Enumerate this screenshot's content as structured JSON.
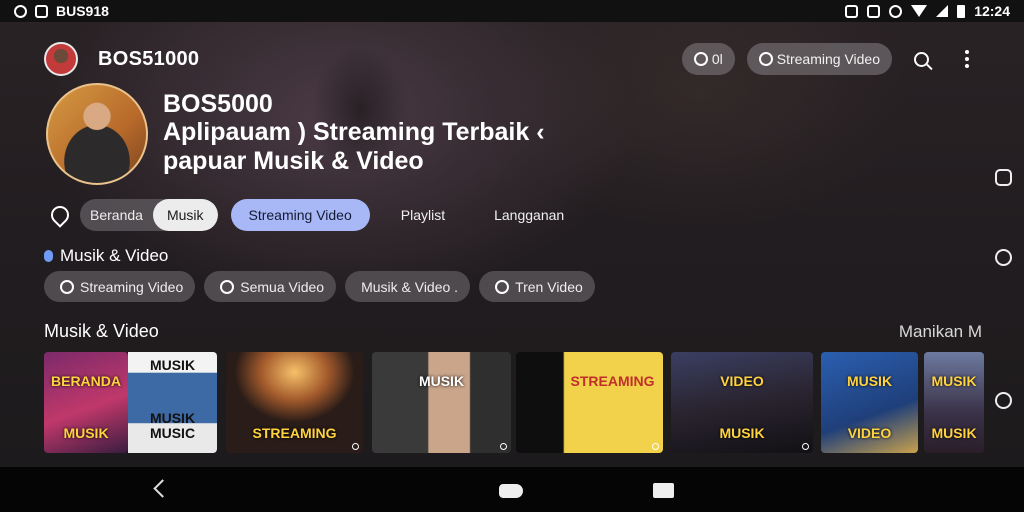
{
  "status_bar": {
    "left_text": "BUS918",
    "time": "12:24"
  },
  "header": {
    "channel_name": "BOS51000",
    "chip_small_label": "0l",
    "search_pill_label": "Streaming Video",
    "icons": [
      "search-icon",
      "more-vertical-icon"
    ]
  },
  "hero": {
    "name": "BOS5000",
    "title_line1": "Aplipauam ) Streaming Terbaik ‹",
    "title_line2": "papuar Musik & Video"
  },
  "tabs": {
    "segment": [
      "Beranda",
      "Musik"
    ],
    "segment_active": 1,
    "items": [
      "Streaming Video",
      "Playlist",
      "Langganan"
    ],
    "active_index": 0
  },
  "filter_section": {
    "label": "Musik & Video",
    "chips": [
      "Streaming Video",
      "Semua Video",
      "Musik & Video .",
      "Tren Video"
    ]
  },
  "content_row": {
    "title": "Musik & Video",
    "more_label": "Manikan M",
    "thumbnails": [
      {
        "caption_top": "BERANDA",
        "caption_bottom": "MUSIK"
      },
      {
        "caption_top": "MUSIK",
        "caption_bottom": "MUSIK MUSIC"
      },
      {
        "caption_top": "",
        "caption_bottom": "STREAMING"
      },
      {
        "caption_top": "MUSIK",
        "caption_bottom": ""
      },
      {
        "caption_top": "STREAMING",
        "caption_bottom": ""
      },
      {
        "caption_top": "VIDEO",
        "caption_bottom": "MUSIK"
      },
      {
        "caption_top": "MUSIK",
        "caption_bottom": "VIDEO"
      },
      {
        "caption_top": "MUSIK",
        "caption_bottom": "MUSIK"
      }
    ]
  },
  "colors": {
    "accent_tab": "#a8b7f6",
    "caption_yellow": "#ffd23f",
    "chip_bg": "#56525a"
  }
}
